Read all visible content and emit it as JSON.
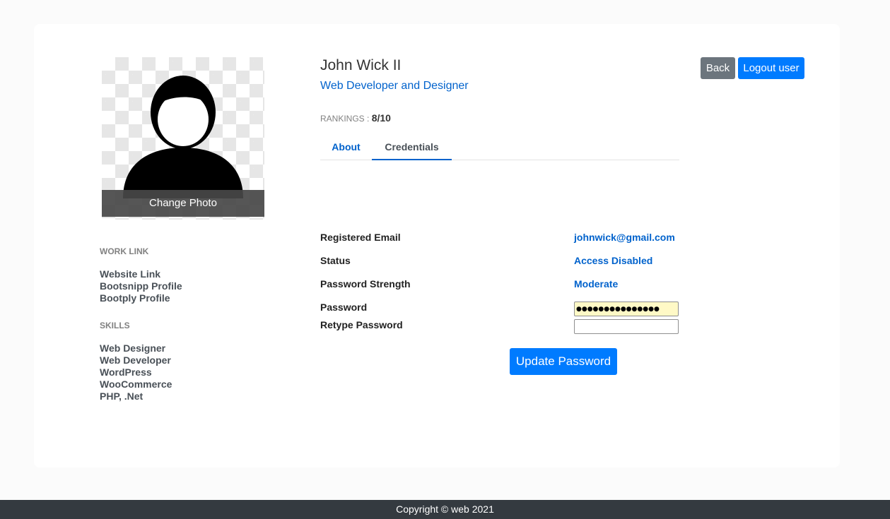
{
  "profile": {
    "name": "John Wick II",
    "role": "Web Developer and Designer",
    "rankings_label": "RANKINGS :",
    "rankings_value": "8/10",
    "change_photo_label": "Change Photo"
  },
  "actions": {
    "back_label": "Back",
    "logout_label": "Logout user"
  },
  "tabs": [
    {
      "label": "About",
      "active": false
    },
    {
      "label": "Credentials",
      "active": true
    }
  ],
  "sidebar": {
    "work_link_heading": "WORK LINK",
    "work_links": [
      "Website Link",
      "Bootsnipp Profile",
      "Bootply Profile"
    ],
    "skills_heading": "SKILLS",
    "skills": [
      "Web Designer",
      "Web Developer",
      "WordPress",
      "WooCommerce",
      "PHP, .Net"
    ]
  },
  "credentials": {
    "email_label": "Registered Email",
    "email_value": "johnwick@gmail.com",
    "status_label": "Status",
    "status_value": "Access Disabled",
    "strength_label": "Password Strength",
    "strength_value": "Moderate",
    "password_label": "Password",
    "password_value": "●●●●●●●●●●●●●●●",
    "retype_label": "Retype Password",
    "retype_value": "",
    "update_label": "Update Password"
  },
  "footer": {
    "text": "Copyright © web 2021"
  },
  "colors": {
    "primary": "#007bff",
    "secondary": "#6c757d",
    "link": "#0062cc",
    "footer_bg": "#343a40",
    "autofill_bg": "#fff9c6"
  }
}
